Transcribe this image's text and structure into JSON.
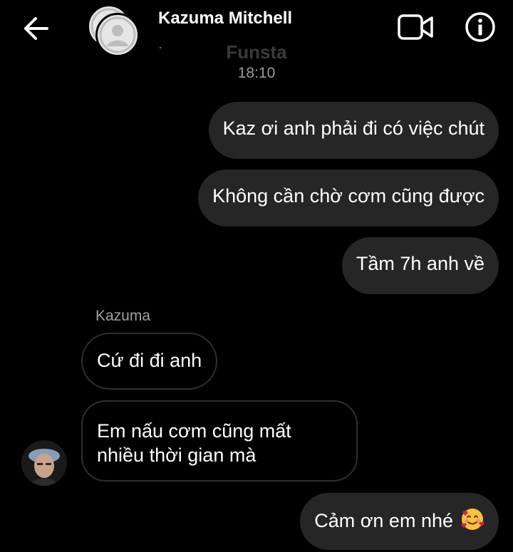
{
  "header": {
    "contact_name": "Kazuma Mitchell",
    "icons": {
      "back": "arrow-left-icon",
      "video": "video-call-icon",
      "info": "info-icon"
    }
  },
  "conversation": {
    "date_label": "Funsta",
    "time_label": "18:10",
    "sender_name": "Kazuma",
    "messages": [
      {
        "from": "me",
        "text": "Kaz ơi anh phải đi có việc chút"
      },
      {
        "from": "me",
        "text": "Không cần chờ cơm cũng được"
      },
      {
        "from": "me",
        "text": "Tầm 7h anh về"
      },
      {
        "from": "them",
        "text": "Cứ đi đi anh"
      },
      {
        "from": "them",
        "text": "Em nấu cơm cũng mất nhiều thời gian mà"
      },
      {
        "from": "me",
        "text": "Cảm ơn em nhé",
        "emoji": "smiling-face-with-hearts-emoji"
      }
    ]
  },
  "colors": {
    "background": "#000000",
    "sent_bubble": "#262626",
    "received_border": "#2f2f2f",
    "muted_text": "#9a9a9a"
  }
}
